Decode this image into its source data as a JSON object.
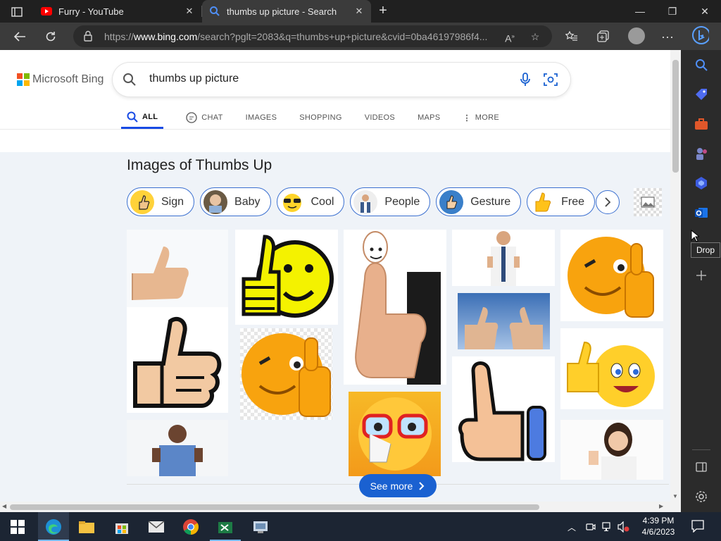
{
  "browser": {
    "tabs": [
      {
        "title": "Furry - YouTube"
      },
      {
        "title": "thumbs up picture - Search"
      }
    ],
    "url_prefix": "https://",
    "url_domain": "www.bing.com",
    "url_rest": "/search?pglt=2083&q=thumbs+up+picture&cvid=0ba46197986f4..."
  },
  "bing": {
    "brand": "Microsoft Bing",
    "query": "thumbs up picture",
    "nav": [
      "ALL",
      "CHAT",
      "IMAGES",
      "SHOPPING",
      "VIDEOS",
      "MAPS",
      "MORE"
    ],
    "images_title": "Images of Thumbs Up",
    "chips": [
      "Sign",
      "Baby",
      "Cool",
      "People",
      "Gesture",
      "Free"
    ],
    "see_more": "See more"
  },
  "sidebar": {
    "tooltip": "Drop"
  },
  "taskbar": {
    "time": "4:39 PM",
    "date": "4/6/2023"
  },
  "colors": {
    "accent": "#174ae4",
    "see_more_bg": "#1a61d1",
    "youtube_red": "#ff0000"
  }
}
